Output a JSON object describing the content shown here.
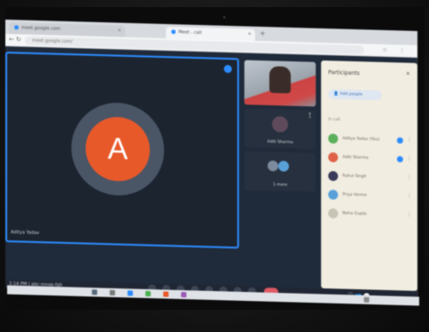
{
  "browser": {
    "tabs": [
      {
        "label": "meet.google.com",
        "active": false
      },
      {
        "label": "Meet - call",
        "active": true
      }
    ],
    "new_tab": "+",
    "address": "meet.google.com/",
    "nav": {
      "back": "←",
      "forward": "→",
      "reload": "↻"
    },
    "toolbar_icons": "☆ ⋮"
  },
  "meet": {
    "main_tile": {
      "avatar_letter": "A",
      "avatar_color": "#e8592a",
      "name": "Aditya Yadav"
    },
    "side_tiles": [
      {
        "type": "video"
      },
      {
        "type": "avatar",
        "name": "Aditi Sharma"
      },
      {
        "type": "avatar-pair",
        "name": "1 more"
      }
    ],
    "panel": {
      "title": "Participants",
      "close": "✕",
      "add_people": "Add people",
      "section": "In call",
      "participants": [
        {
          "name": "Aditya Yadav (You)",
          "color": "#5bb05b"
        },
        {
          "name": "Aditi Sharma",
          "color": "#e0614a"
        },
        {
          "name": "Rahul Singh",
          "color": "#3a3a5a"
        },
        {
          "name": "Priya Verma",
          "color": "#5aa0d8"
        },
        {
          "name": "Neha Gupta",
          "color": "#c8c4b4"
        }
      ]
    },
    "controls": {
      "meeting_time": "2:14 PM | abc-mnop-fgh",
      "right_icons": "ⓘ 👥 💬 ⋯"
    }
  },
  "colors": {
    "accent": "#2d8cff",
    "end_call": "#e05a64"
  }
}
